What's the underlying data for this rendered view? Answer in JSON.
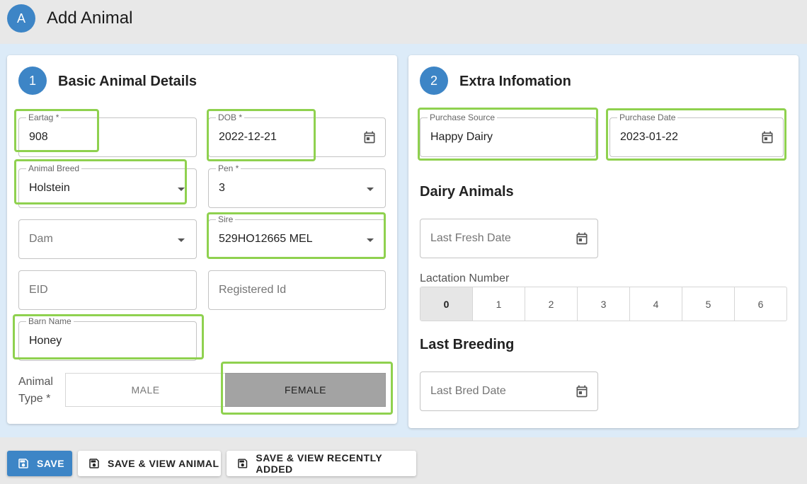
{
  "header": {
    "avatar_letter": "A",
    "title": "Add Animal"
  },
  "card1": {
    "step": "1",
    "title": "Basic Animal Details",
    "eartag": {
      "label": "Eartag *",
      "value": "908"
    },
    "dob": {
      "label": "DOB *",
      "value": "2022-12-21"
    },
    "breed": {
      "label": "Animal Breed",
      "value": "Holstein"
    },
    "pen": {
      "label": "Pen *",
      "value": "3"
    },
    "dam": {
      "placeholder": "Dam"
    },
    "sire": {
      "label": "Sire",
      "value": "529HO12665 MEL"
    },
    "eid": {
      "placeholder": "EID"
    },
    "registered_id": {
      "placeholder": "Registered Id"
    },
    "barn_name": {
      "label": "Barn Name",
      "value": "Honey"
    },
    "animal_type": {
      "label_line1": "Animal",
      "label_line2": "Type *",
      "male": "MALE",
      "female": "FEMALE",
      "selected": "FEMALE"
    }
  },
  "card2": {
    "step": "2",
    "title": "Extra Infomation",
    "purchase_source": {
      "label": "Purchase Source",
      "value": "Happy Dairy"
    },
    "purchase_date": {
      "label": "Purchase Date",
      "value": "2023-01-22"
    },
    "dairy_heading": "Dairy Animals",
    "last_fresh": {
      "placeholder": "Last Fresh Date"
    },
    "lactation": {
      "label": "Lactation Number",
      "options": [
        "0",
        "1",
        "2",
        "3",
        "4",
        "5",
        "6"
      ],
      "selected": "0"
    },
    "breeding_heading": "Last Breeding",
    "last_bred": {
      "placeholder": "Last Bred Date"
    }
  },
  "footer": {
    "save": "SAVE",
    "save_view_animal": "SAVE & VIEW ANIMAL",
    "save_view_recent": "SAVE & VIEW RECENTLY ADDED"
  },
  "colors": {
    "accent": "#3d85c6",
    "highlight": "#8fd14f",
    "content_bg": "#dcebf8"
  }
}
